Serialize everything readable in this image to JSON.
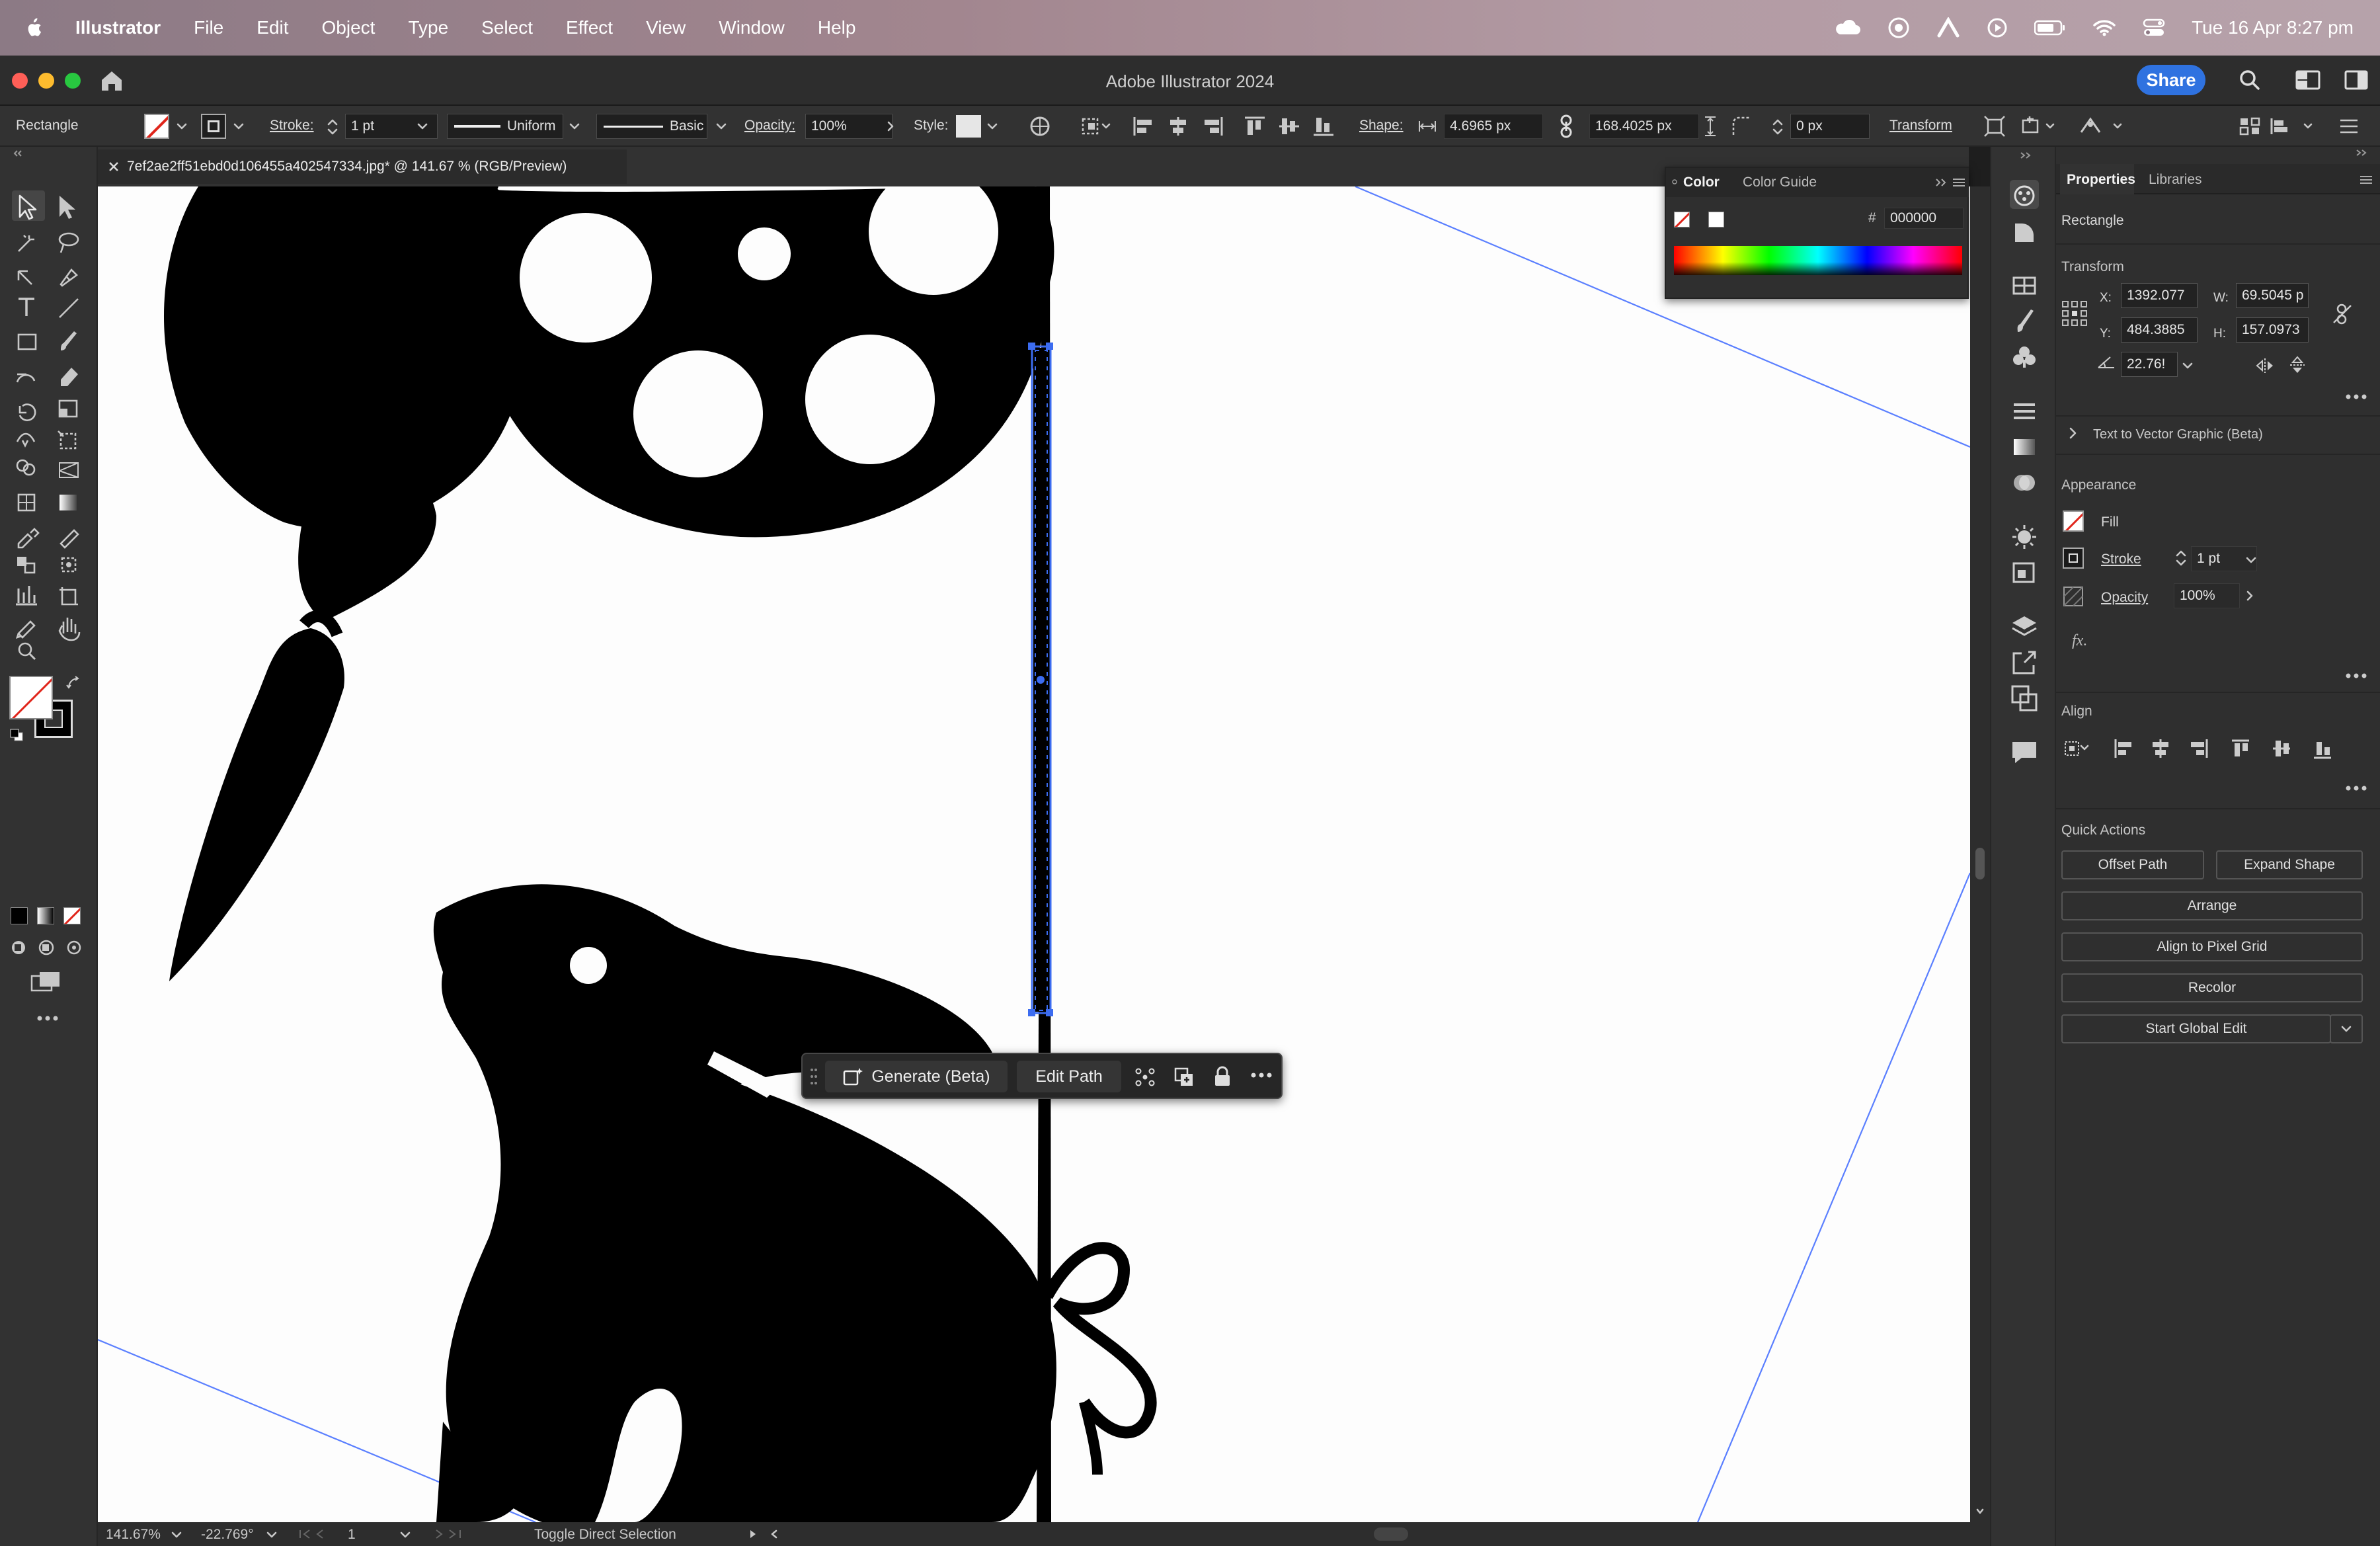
{
  "menubar": {
    "apple": "",
    "app": "Illustrator",
    "items": [
      "File",
      "Edit",
      "Object",
      "Type",
      "Select",
      "Effect",
      "View",
      "Window",
      "Help"
    ],
    "datetime": "Tue 16 Apr  8:27 pm"
  },
  "window": {
    "title": "Adobe Illustrator 2024",
    "share_label": "Share"
  },
  "control_bar": {
    "selection_type": "Rectangle",
    "stroke_label": "Stroke:",
    "stroke_value": "1 pt",
    "profile": "Uniform",
    "brush": "Basic",
    "opacity_label": "Opacity:",
    "opacity_value": "100%",
    "style_label": "Style:",
    "shape_label": "Shape:",
    "shape_width": "4.6965 px",
    "shape_height": "168.4025 px",
    "corner_value": "0 px",
    "transform_label": "Transform"
  },
  "document": {
    "tab_title": "7ef2ae2ff51ebd0d106455a402547334.jpg* @ 141.67 % (RGB/Preview)"
  },
  "status_bar": {
    "zoom": "141.67%",
    "rotation": "-22.769°",
    "artboard": "1",
    "tool_hint": "Toggle Direct Selection"
  },
  "color_panel": {
    "tab_color": "Color",
    "tab_guide": "Color Guide",
    "hash": "#",
    "hex_value": "000000"
  },
  "context_bar": {
    "generate_label": "Generate (Beta)",
    "edit_path_label": "Edit Path"
  },
  "properties": {
    "tab_properties": "Properties",
    "tab_libraries": "Libraries",
    "object_type": "Rectangle",
    "transform_title": "Transform",
    "x_label": "X:",
    "x_value": "1392.077",
    "y_label": "Y:",
    "y_value": "484.3885",
    "w_label": "W:",
    "w_value": "69.5045 p",
    "h_label": "H:",
    "h_value": "157.0973",
    "angle_value": "22.76!",
    "text_to_vector": "Text to Vector Graphic (Beta)",
    "appearance_title": "Appearance",
    "fill_label": "Fill",
    "stroke_label": "Stroke",
    "stroke_value": "1 pt",
    "opacity_label": "Opacity",
    "opacity_value": "100%",
    "fx_label": "fx.",
    "align_title": "Align",
    "quick_actions_title": "Quick Actions",
    "offset_path": "Offset Path",
    "expand_shape": "Expand Shape",
    "arrange": "Arrange",
    "align_pixel_grid": "Align to Pixel Grid",
    "recolor": "Recolor",
    "start_global_edit": "Start Global Edit"
  },
  "colors": {
    "accent": "#2f72e0",
    "selection": "#3c6cf0",
    "panel": "#2f2f2f",
    "artwork": "#000000"
  }
}
